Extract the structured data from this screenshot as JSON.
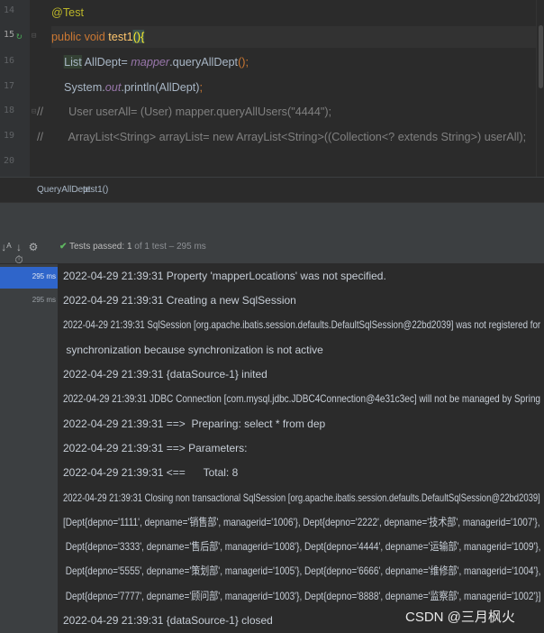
{
  "editor": {
    "gutter": [
      "14",
      "15",
      "16",
      "17",
      "18",
      "19",
      "20"
    ],
    "lines": [
      {
        "parts": [
          {
            "t": "@Test",
            "c": "ann"
          }
        ]
      },
      {
        "parts": [
          {
            "t": "public void ",
            "c": "kw"
          },
          {
            "t": "test1",
            "c": "fn"
          },
          {
            "t": "()",
            "c": "paren"
          },
          {
            "t": "{",
            "c": "paren"
          }
        ]
      },
      {
        "parts": [
          {
            "t": "    ",
            "c": ""
          },
          {
            "t": "List",
            "c": "cls-hl"
          },
          {
            "t": " AllDept= ",
            "c": ""
          },
          {
            "t": "mapper",
            "c": "field"
          },
          {
            "t": ".queryAllDept",
            "c": ""
          },
          {
            "t": "();",
            "c": "kw"
          }
        ]
      },
      {
        "parts": [
          {
            "t": "    System.",
            "c": ""
          },
          {
            "t": "out",
            "c": "field"
          },
          {
            "t": ".println(AllDept)",
            "c": ""
          },
          {
            "t": ";",
            "c": "kw"
          }
        ]
      },
      {
        "parts": [
          {
            "t": "//        User userAll= (User) mapper.queryAllUsers(\"4444\");",
            "c": "cmt"
          }
        ]
      },
      {
        "parts": [
          {
            "t": "//        ArrayList<String> arrayList= new ArrayList<String>((Collection<? extends String>) userAll);",
            "c": "cmt"
          }
        ]
      },
      {
        "parts": [
          {
            "t": "",
            "c": ""
          }
        ]
      }
    ]
  },
  "breadcrumbs": [
    "QueryAllDept",
    "test1()"
  ],
  "toolbar": {
    "status_label": "Tests passed:",
    "status_count": "1",
    "status_rest": "of 1 test – 295 ms"
  },
  "tree": {
    "times": [
      "295 ms",
      "295 ms"
    ]
  },
  "console": {
    "lines": [
      "2022-04-29 21:39:31 Property 'mapperLocations' was not specified.",
      "2022-04-29 21:39:31 Creating a new SqlSession",
      "2022-04-29 21:39:31 SqlSession [org.apache.ibatis.session.defaults.DefaultSqlSession@22bd2039] was not registered for",
      " synchronization because synchronization is not active",
      "2022-04-29 21:39:31 {dataSource-1} inited",
      "2022-04-29 21:39:31 JDBC Connection [com.mysql.jdbc.JDBC4Connection@4e31c3ec] will not be managed by Spring",
      "2022-04-29 21:39:31 ==>  Preparing: select * from dep",
      "2022-04-29 21:39:31 ==> Parameters:",
      "2022-04-29 21:39:31 <==      Total: 8",
      "2022-04-29 21:39:31 Closing non transactional SqlSession [org.apache.ibatis.session.defaults.DefaultSqlSession@22bd2039]",
      "[Dept{depno='1111', depname='销售部', managerid='1006'}, Dept{depno='2222', depname='技术部', managerid='1007'},",
      " Dept{depno='3333', depname='售后部', managerid='1008'}, Dept{depno='4444', depname='运输部', managerid='1009'},",
      " Dept{depno='5555', depname='策划部', managerid='1005'}, Dept{depno='6666', depname='维修部', managerid='1004'},",
      " Dept{depno='7777', depname='顾问部', managerid='1003'}, Dept{depno='8888', depname='监察部', managerid='1002'}]",
      "2022-04-29 21:39:31 {dataSource-1} closed"
    ]
  },
  "watermark": "CSDN @三月枫火",
  "colors": {
    "accent": "#2f65ca",
    "pass": "#5fb760",
    "keyword": "#cc7832",
    "method": "#ffc66d"
  }
}
